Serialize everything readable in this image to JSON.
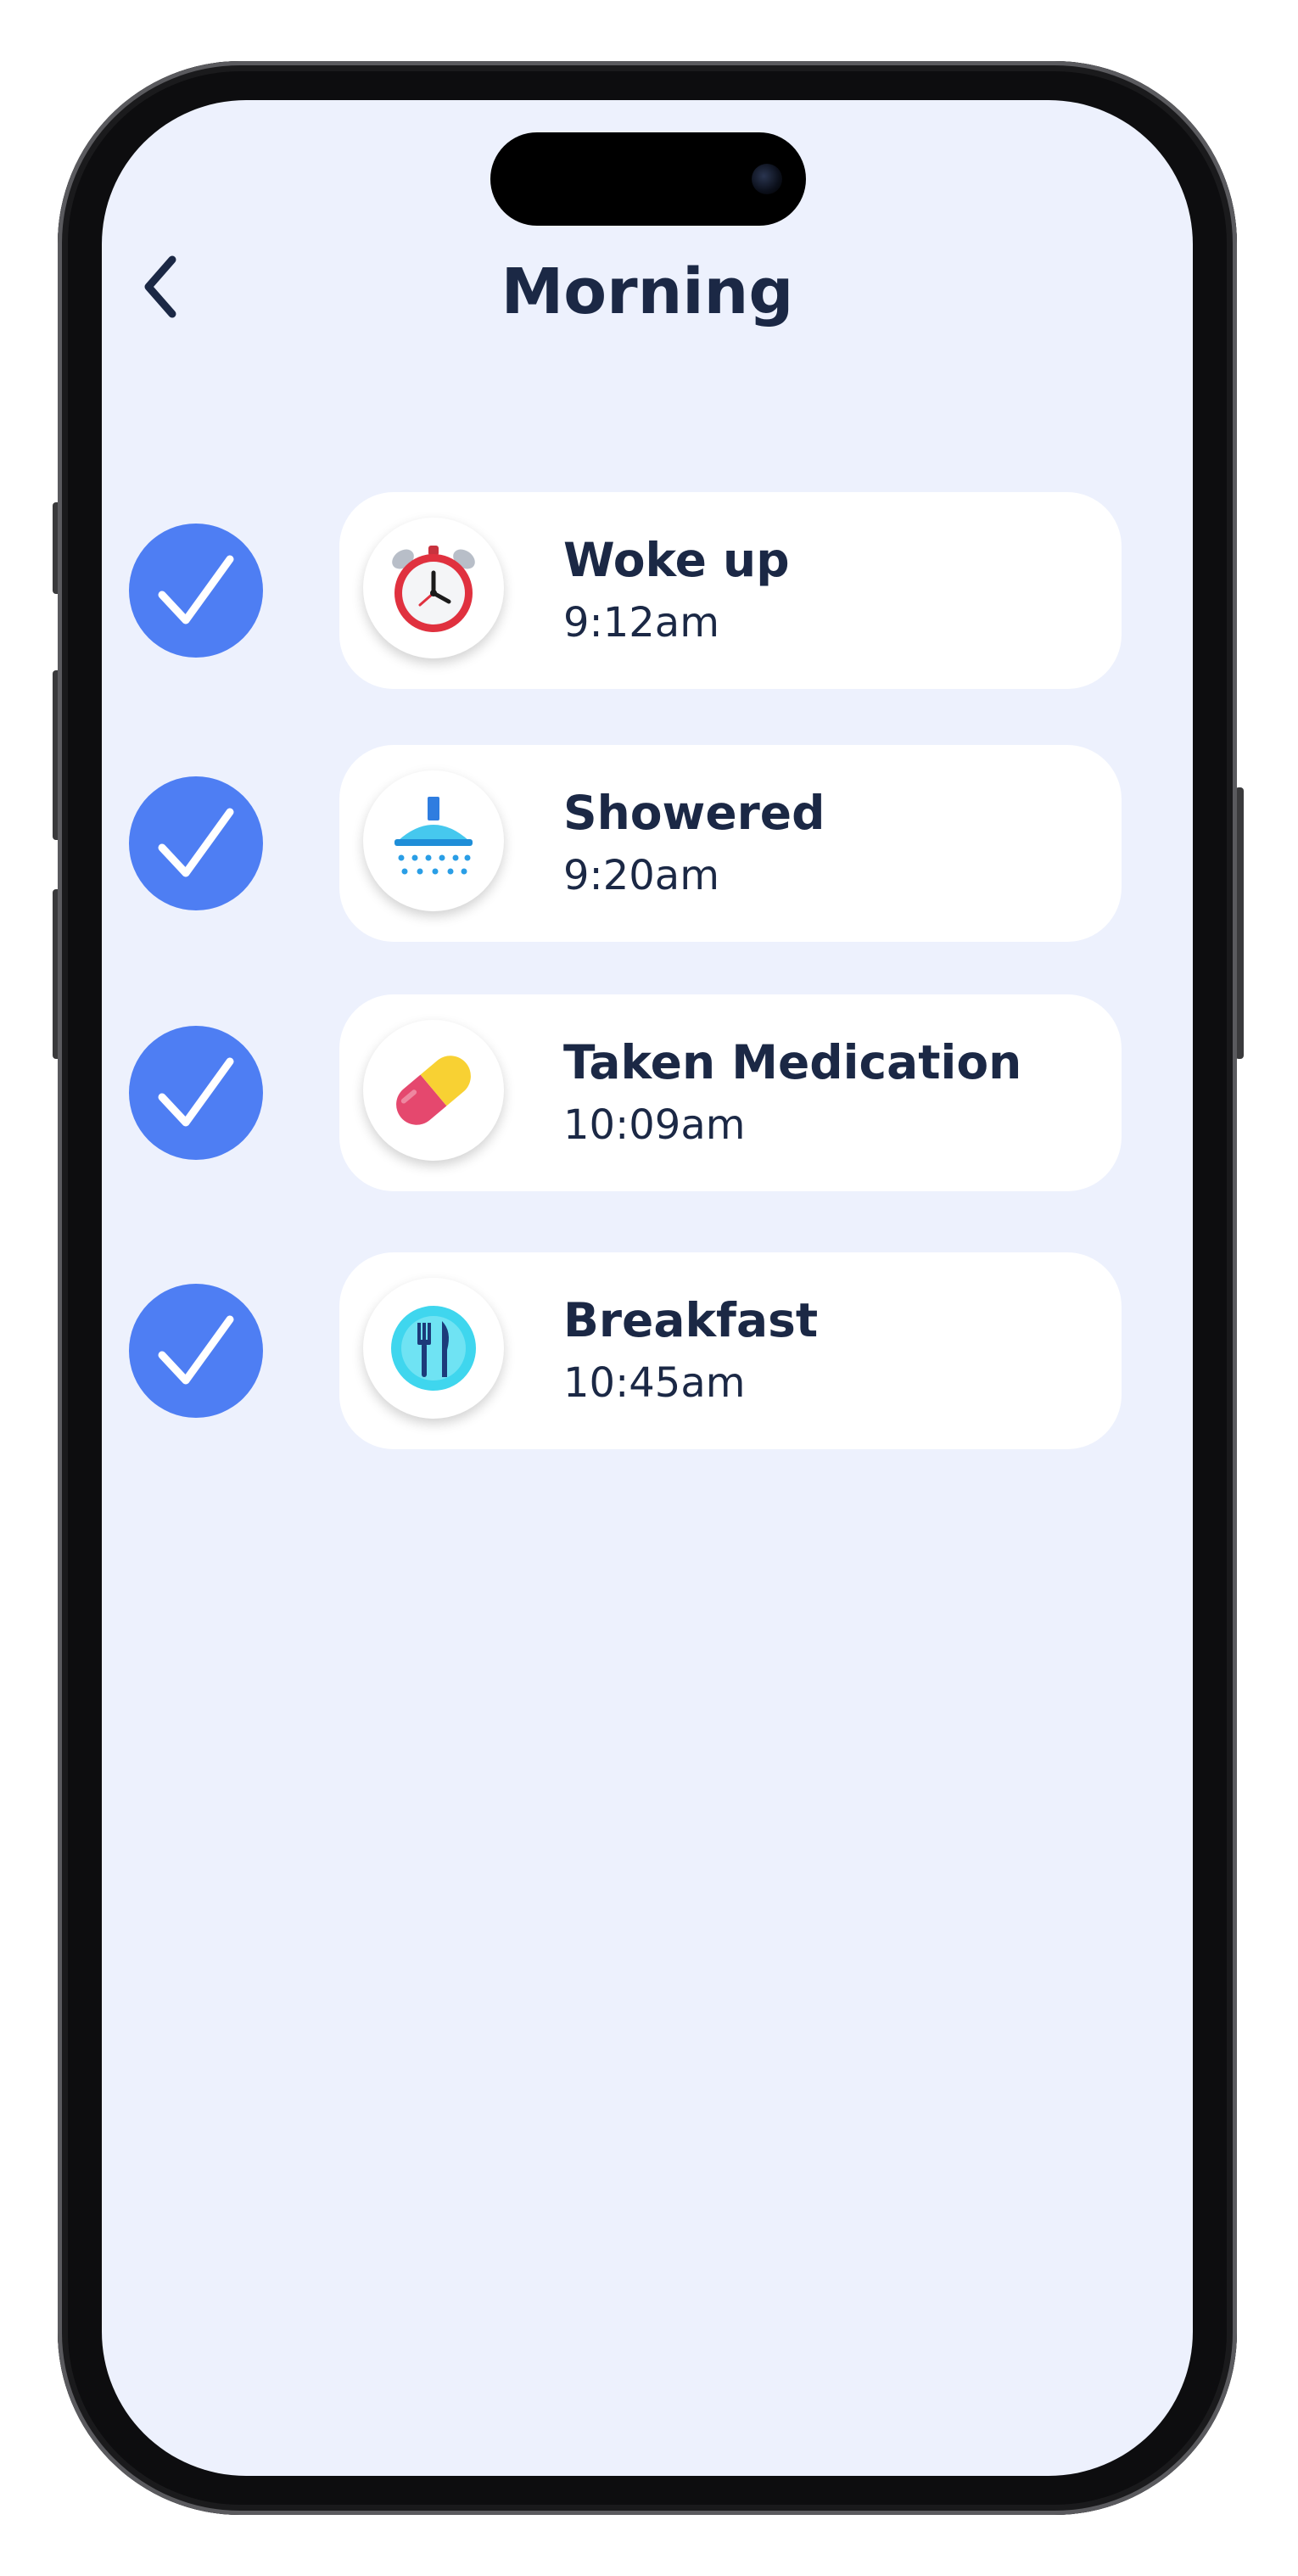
{
  "header": {
    "back_icon": "chevron-left-icon",
    "title": "Morning"
  },
  "activities": [
    {
      "label": "Woke up",
      "time": "9:12am",
      "icon": "alarm-clock-icon",
      "completed": true
    },
    {
      "label": "Showered",
      "time": "9:20am",
      "icon": "shower-icon",
      "completed": true
    },
    {
      "label": "Taken Medication",
      "time": "10:09am",
      "icon": "pill-icon",
      "completed": true
    },
    {
      "label": "Breakfast",
      "time": "10:45am",
      "icon": "plate-cutlery-icon",
      "completed": true
    }
  ],
  "colors": {
    "accent": "#4e7ef3",
    "background": "#edf1fd",
    "text": "#1b2845",
    "card": "#ffffff"
  }
}
